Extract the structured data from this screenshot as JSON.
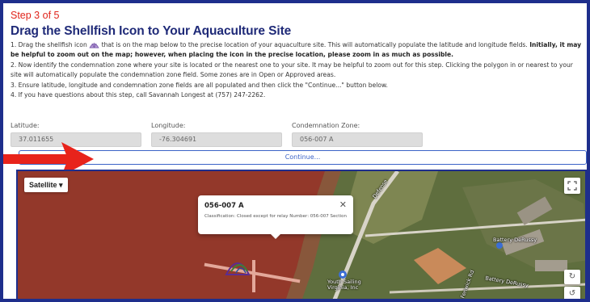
{
  "step": "Step 3 of 5",
  "title": "Drag the Shellfish Icon to Your Aquaculture Site",
  "instructions": {
    "line1_pre": "1. Drag the shellfish icon",
    "line1_post": "that is on the map below to the precise location of your aquaculture site. This will automatically populate the latitude and longitude fields.",
    "line1_bold": "Initially, it may be helpful to zoom out on the map; however, when placing the icon in the precise location, please zoom in as much as possible.",
    "line2": "2. Now identify the condemnation zone where your site is located or the nearest one to your site. It may be helpful to zoom out for this step. Clicking the polygon in or nearest to your site will automatically populate the condemnation zone field. Some zones are in Open or Approved areas.",
    "line3": "3. Ensure latitude, longitude and condemnation zone fields are all populated and then click the \"Continue...\" button below.",
    "line4": "4. If you have questions about this step, call Savannah Longest at (757) 247-2262."
  },
  "fields": {
    "latitude_label": "Latitude:",
    "latitude_value": "37.011655",
    "longitude_label": "Longitude:",
    "longitude_value": "-76.304691",
    "zone_label": "Condemnation Zone:",
    "zone_value": "056-007  A"
  },
  "continue_label": "Continue...",
  "map": {
    "type_button": "Satellite",
    "popup_title": "056-007 A",
    "popup_classification": "Classification: Closed except for relay Number: 056-007 Section: A",
    "labels": {
      "battery_derussy": "Battery DeRussy",
      "battery_derussy_road": "Battery DeRussy",
      "youth_sailing": "Youth Sailing Virginia, Inc",
      "road_defense": "Defense",
      "road_fenwick": "Fenwick Rd"
    }
  },
  "colors": {
    "accent_red": "#e0241b",
    "title_navy": "#1f2a78",
    "border_navy": "#1e2e8c",
    "button_blue": "#3b63c7"
  }
}
